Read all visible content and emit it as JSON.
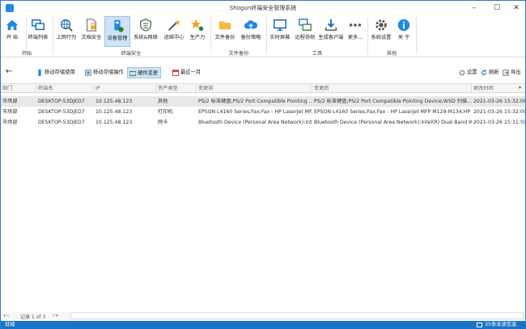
{
  "window": {
    "title": "Shogun终端安全管理系统",
    "minimize": "–",
    "maximize": "☐",
    "close": "✕"
  },
  "ribbon": {
    "buttons": [
      {
        "label": "开 始"
      },
      {
        "label": "终端列表"
      },
      {
        "label": "上网行为"
      },
      {
        "label": "文档安全"
      },
      {
        "label": "设备管理"
      },
      {
        "label": "系统&网络"
      },
      {
        "label": "运维中心"
      },
      {
        "label": "生产力"
      },
      {
        "label": "文件备份"
      },
      {
        "label": "备份策略"
      },
      {
        "label": "实时屏幕"
      },
      {
        "label": "远程协助"
      },
      {
        "label": "生成客户端"
      },
      {
        "label": "更多..."
      },
      {
        "label": "系统设置"
      },
      {
        "label": "关 于"
      }
    ],
    "groups": [
      "开始",
      "终端安全",
      "文件备份",
      "工具",
      "其他"
    ]
  },
  "toolbar": {
    "back": "←",
    "mobile_storage_use": "移动存储使用",
    "mobile_storage_ops": "移动存储操作",
    "hardware_change": "硬件变更",
    "recent_month": "最近一月",
    "settings": "设置",
    "refresh": "刷新",
    "export": "导出"
  },
  "table": {
    "headers": [
      "部门",
      "终端名",
      "IP",
      "资产类型",
      "变更前",
      "变更后",
      "更改时间"
    ],
    "rows": [
      [
        "市场部",
        "DESKTOP-53DJED7",
        "10.125.48.123",
        "其他",
        "PS/2 标准键盘;PS/2 Port Compatible Pointing ...",
        "PS/2 标准键盘;PS/2 Port Compatible Pointing Device;WSD 扫描...",
        "2021-03-26 15:32:00"
      ],
      [
        "市场部",
        "DESKTOP-53DJED7",
        "10.125.48.123",
        "打印机",
        "EPSON L4160 Series;Fax;Fax - HP LaserJet MF...",
        "EPSON L4160 Series;Fax;Fax - HP LaserJet MFP M129-M134;HP ...",
        "2021-03-26 15:32:00"
      ],
      [
        "市场部",
        "DESKTOP-53DJED7",
        "10.125.48.123",
        "网卡",
        "Bluetooth Device (Personal Area Network);Intel...",
        "Bluetooth Device (Personal Area Network);Intel(R) Dual Band Wi...",
        "2021-03-26 15:31:59"
      ]
    ]
  },
  "pager": {
    "text": "记录 1 of 3"
  },
  "status": {
    "left": "就绪",
    "right": "35条未读信息"
  },
  "colors": {
    "accent": "#1a73c8",
    "selection": "#cfe3f8"
  }
}
